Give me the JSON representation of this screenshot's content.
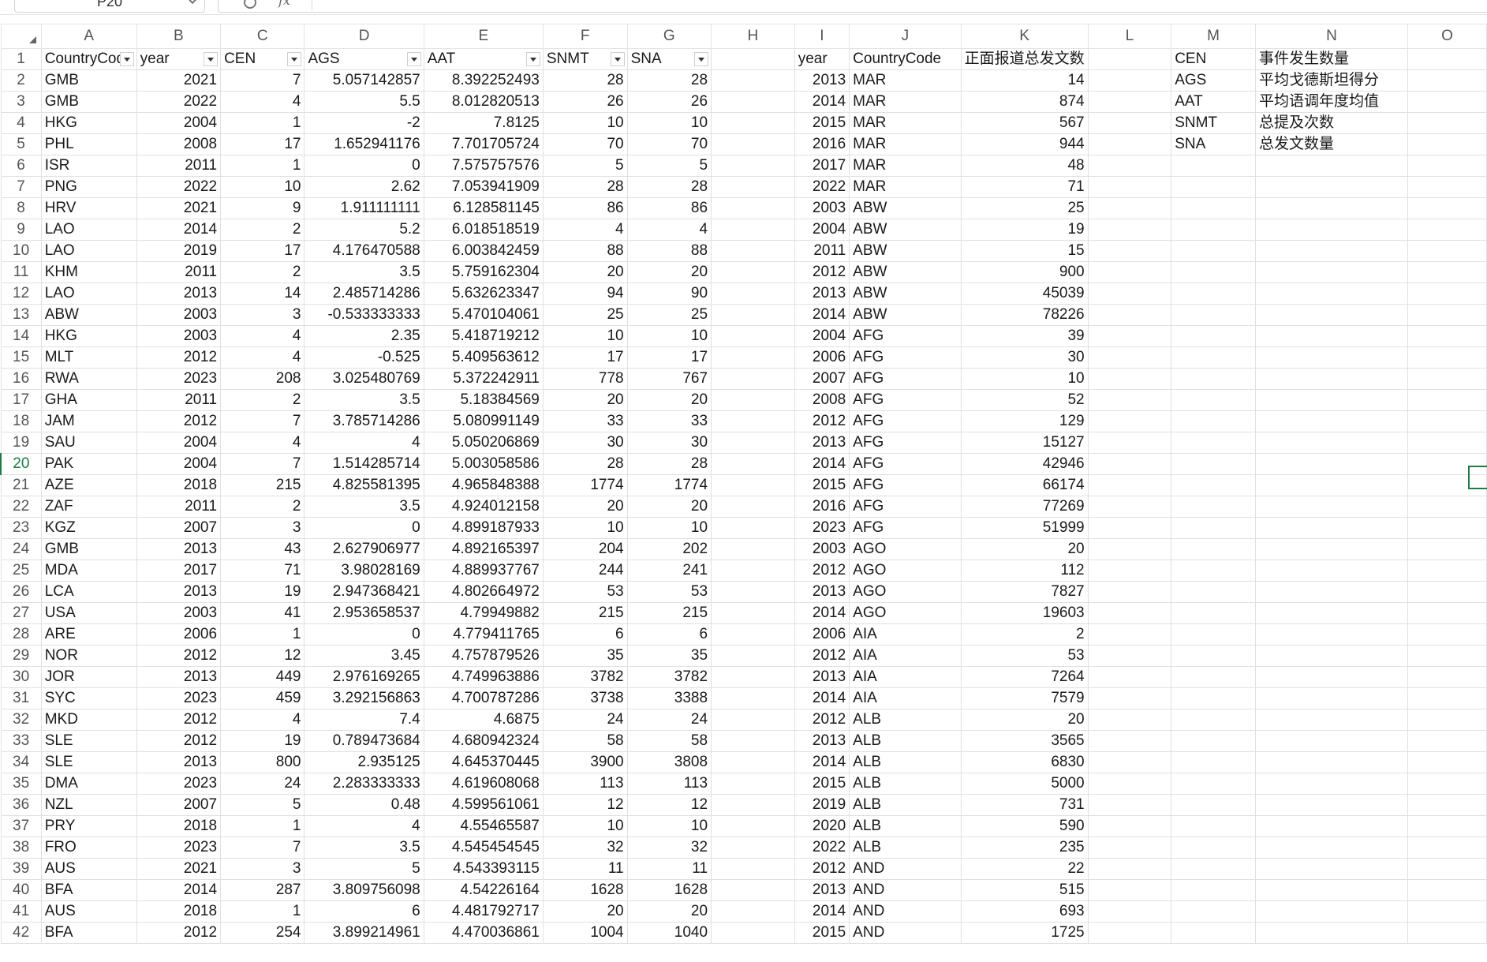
{
  "formula_bar": {
    "name_box": "P20",
    "fx_label": "fx"
  },
  "columns": [
    "A",
    "B",
    "C",
    "D",
    "E",
    "F",
    "G",
    "H",
    "I",
    "J",
    "K",
    "L",
    "M",
    "N",
    "O"
  ],
  "row_numbers": [
    1,
    2,
    3,
    4,
    5,
    6,
    7,
    8,
    9,
    10,
    11,
    12,
    13,
    14,
    15,
    16,
    17,
    18,
    19,
    20,
    21,
    22,
    23,
    24,
    25,
    26,
    27,
    28,
    29,
    30,
    31,
    32,
    33,
    34,
    35,
    36,
    37,
    38,
    39,
    40,
    41,
    42
  ],
  "active_row": 20,
  "header_row": {
    "A": "CountryCode",
    "B": "year",
    "C": "CEN",
    "D": "AGS",
    "E": "AAT",
    "F": "SNMT",
    "G": "SNA",
    "H": "",
    "I": "year",
    "J": "CountryCode",
    "K": "正面报道总发文数",
    "L": "",
    "M": "CEN",
    "N": "事件发生数量",
    "O": ""
  },
  "legend": [
    {
      "code": "AGS",
      "desc": "平均戈德斯坦得分"
    },
    {
      "code": "AAT",
      "desc": "平均语调年度均值"
    },
    {
      "code": "SNMT",
      "desc": "总提及次数"
    },
    {
      "code": "SNA",
      "desc": "总发文数量"
    }
  ],
  "rows": [
    [
      "GMB",
      "2021",
      "7",
      "5.057142857",
      "8.392252493",
      "28",
      "28",
      "",
      "2013",
      "MAR",
      "14"
    ],
    [
      "GMB",
      "2022",
      "4",
      "5.5",
      "8.012820513",
      "26",
      "26",
      "",
      "2014",
      "MAR",
      "874"
    ],
    [
      "HKG",
      "2004",
      "1",
      "-2",
      "7.8125",
      "10",
      "10",
      "",
      "2015",
      "MAR",
      "567"
    ],
    [
      "PHL",
      "2008",
      "17",
      "1.652941176",
      "7.701705724",
      "70",
      "70",
      "",
      "2016",
      "MAR",
      "944"
    ],
    [
      "ISR",
      "2011",
      "1",
      "0",
      "7.575757576",
      "5",
      "5",
      "",
      "2017",
      "MAR",
      "48"
    ],
    [
      "PNG",
      "2022",
      "10",
      "2.62",
      "7.053941909",
      "28",
      "28",
      "",
      "2022",
      "MAR",
      "71"
    ],
    [
      "HRV",
      "2021",
      "9",
      "1.911111111",
      "6.128581145",
      "86",
      "86",
      "",
      "2003",
      "ABW",
      "25"
    ],
    [
      "LAO",
      "2014",
      "2",
      "5.2",
      "6.018518519",
      "4",
      "4",
      "",
      "2004",
      "ABW",
      "19"
    ],
    [
      "LAO",
      "2019",
      "17",
      "4.176470588",
      "6.003842459",
      "88",
      "88",
      "",
      "2011",
      "ABW",
      "15"
    ],
    [
      "KHM",
      "2011",
      "2",
      "3.5",
      "5.759162304",
      "20",
      "20",
      "",
      "2012",
      "ABW",
      "900"
    ],
    [
      "LAO",
      "2013",
      "14",
      "2.485714286",
      "5.632623347",
      "94",
      "90",
      "",
      "2013",
      "ABW",
      "45039"
    ],
    [
      "ABW",
      "2003",
      "3",
      "-0.533333333",
      "5.470104061",
      "25",
      "25",
      "",
      "2014",
      "ABW",
      "78226"
    ],
    [
      "HKG",
      "2003",
      "4",
      "2.35",
      "5.418719212",
      "10",
      "10",
      "",
      "2004",
      "AFG",
      "39"
    ],
    [
      "MLT",
      "2012",
      "4",
      "-0.525",
      "5.409563612",
      "17",
      "17",
      "",
      "2006",
      "AFG",
      "30"
    ],
    [
      "RWA",
      "2023",
      "208",
      "3.025480769",
      "5.372242911",
      "778",
      "767",
      "",
      "2007",
      "AFG",
      "10"
    ],
    [
      "GHA",
      "2011",
      "2",
      "3.5",
      "5.18384569",
      "20",
      "20",
      "",
      "2008",
      "AFG",
      "52"
    ],
    [
      "JAM",
      "2012",
      "7",
      "3.785714286",
      "5.080991149",
      "33",
      "33",
      "",
      "2012",
      "AFG",
      "129"
    ],
    [
      "SAU",
      "2004",
      "4",
      "4",
      "5.050206869",
      "30",
      "30",
      "",
      "2013",
      "AFG",
      "15127"
    ],
    [
      "PAK",
      "2004",
      "7",
      "1.514285714",
      "5.003058586",
      "28",
      "28",
      "",
      "2014",
      "AFG",
      "42946"
    ],
    [
      "AZE",
      "2018",
      "215",
      "4.825581395",
      "4.965848388",
      "1774",
      "1774",
      "",
      "2015",
      "AFG",
      "66174"
    ],
    [
      "ZAF",
      "2011",
      "2",
      "3.5",
      "4.924012158",
      "20",
      "20",
      "",
      "2016",
      "AFG",
      "77269"
    ],
    [
      "KGZ",
      "2007",
      "3",
      "0",
      "4.899187933",
      "10",
      "10",
      "",
      "2023",
      "AFG",
      "51999"
    ],
    [
      "GMB",
      "2013",
      "43",
      "2.627906977",
      "4.892165397",
      "204",
      "202",
      "",
      "2003",
      "AGO",
      "20"
    ],
    [
      "MDA",
      "2017",
      "71",
      "3.98028169",
      "4.889937767",
      "244",
      "241",
      "",
      "2012",
      "AGO",
      "112"
    ],
    [
      "LCA",
      "2013",
      "19",
      "2.947368421",
      "4.802664972",
      "53",
      "53",
      "",
      "2013",
      "AGO",
      "7827"
    ],
    [
      "USA",
      "2003",
      "41",
      "2.953658537",
      "4.79949882",
      "215",
      "215",
      "",
      "2014",
      "AGO",
      "19603"
    ],
    [
      "ARE",
      "2006",
      "1",
      "0",
      "4.779411765",
      "6",
      "6",
      "",
      "2006",
      "AIA",
      "2"
    ],
    [
      "NOR",
      "2012",
      "12",
      "3.45",
      "4.757879526",
      "35",
      "35",
      "",
      "2012",
      "AIA",
      "53"
    ],
    [
      "JOR",
      "2013",
      "449",
      "2.976169265",
      "4.749963886",
      "3782",
      "3782",
      "",
      "2013",
      "AIA",
      "7264"
    ],
    [
      "SYC",
      "2023",
      "459",
      "3.292156863",
      "4.700787286",
      "3738",
      "3388",
      "",
      "2014",
      "AIA",
      "7579"
    ],
    [
      "MKD",
      "2012",
      "4",
      "7.4",
      "4.6875",
      "24",
      "24",
      "",
      "2012",
      "ALB",
      "20"
    ],
    [
      "SLE",
      "2012",
      "19",
      "0.789473684",
      "4.680942324",
      "58",
      "58",
      "",
      "2013",
      "ALB",
      "3565"
    ],
    [
      "SLE",
      "2013",
      "800",
      "2.935125",
      "4.645370445",
      "3900",
      "3808",
      "",
      "2014",
      "ALB",
      "6830"
    ],
    [
      "DMA",
      "2023",
      "24",
      "2.283333333",
      "4.619608068",
      "113",
      "113",
      "",
      "2015",
      "ALB",
      "5000"
    ],
    [
      "NZL",
      "2007",
      "5",
      "0.48",
      "4.599561061",
      "12",
      "12",
      "",
      "2019",
      "ALB",
      "731"
    ],
    [
      "PRY",
      "2018",
      "1",
      "4",
      "4.55465587",
      "10",
      "10",
      "",
      "2020",
      "ALB",
      "590"
    ],
    [
      "FRO",
      "2023",
      "7",
      "3.5",
      "4.545454545",
      "32",
      "32",
      "",
      "2022",
      "ALB",
      "235"
    ],
    [
      "AUS",
      "2021",
      "3",
      "5",
      "4.543393115",
      "11",
      "11",
      "",
      "2012",
      "AND",
      "22"
    ],
    [
      "BFA",
      "2014",
      "287",
      "3.809756098",
      "4.54226164",
      "1628",
      "1628",
      "",
      "2013",
      "AND",
      "515"
    ],
    [
      "AUS",
      "2018",
      "1",
      "6",
      "4.481792717",
      "20",
      "20",
      "",
      "2014",
      "AND",
      "693"
    ],
    [
      "BFA",
      "2012",
      "254",
      "3.899214961",
      "4.470036861",
      "1004",
      "1040",
      "",
      "2015",
      "AND",
      "1725"
    ]
  ]
}
